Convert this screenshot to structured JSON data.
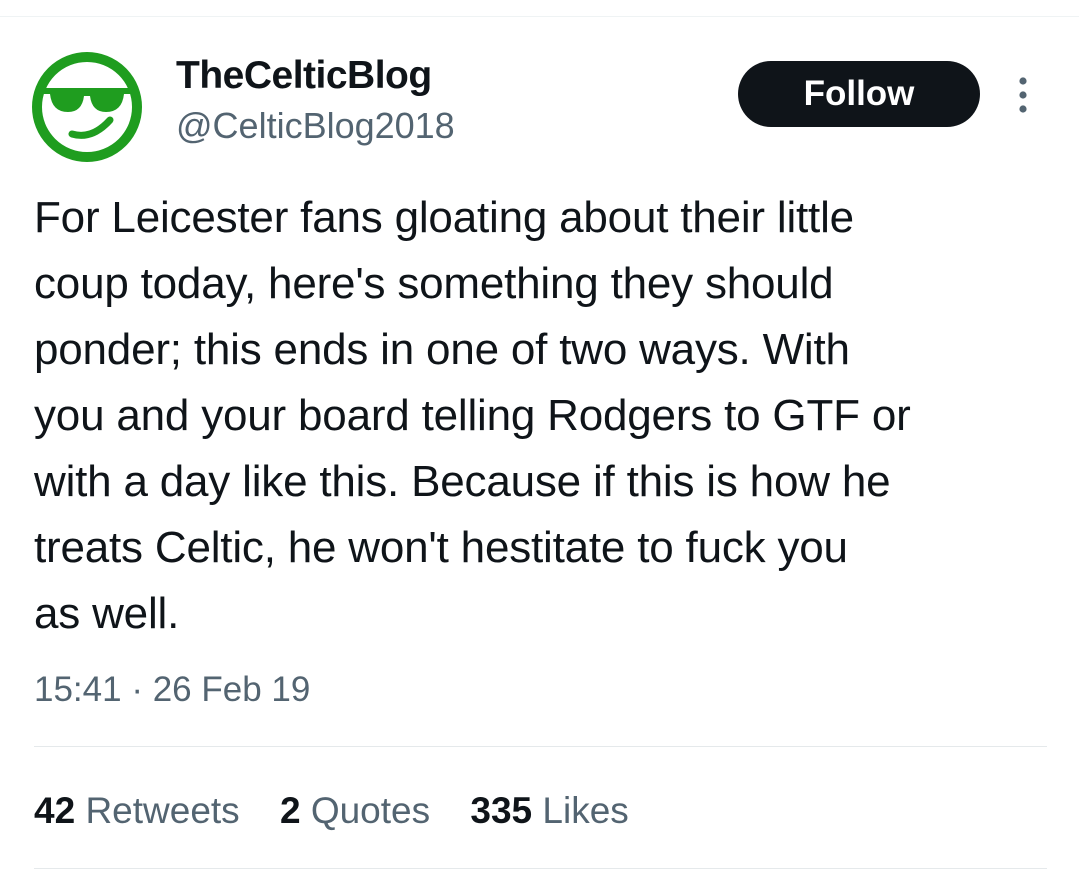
{
  "author": {
    "display_name": "TheCelticBlog",
    "handle": "@CelticBlog2018",
    "avatar_icon": "sunglasses-smiley-icon",
    "avatar_color": "#1f9d1f"
  },
  "follow_button": {
    "label": "Follow"
  },
  "more_menu": {
    "icon": "vertical-ellipsis-icon"
  },
  "tweet": {
    "lines": [
      "For Leicester fans gloating about their little",
      "coup today, here's something they should",
      "ponder; this ends in one of two ways. With",
      "you and your board telling Rodgers to GTF or",
      "with a day like this. Because if this is how he",
      "treats Celtic, he won't hestitate to fuck you",
      "as well."
    ],
    "time": "15:41",
    "separator": "·",
    "date": "26 Feb 19"
  },
  "stats": {
    "retweets": {
      "count": "42",
      "label": "Retweets"
    },
    "quotes": {
      "count": "2",
      "label": "Quotes"
    },
    "likes": {
      "count": "335",
      "label": "Likes"
    }
  },
  "colors": {
    "text_primary": "#0f1419",
    "text_secondary": "#536471",
    "button_bg": "#0f1419",
    "button_text": "#ffffff",
    "divider": "#eff3f4"
  }
}
